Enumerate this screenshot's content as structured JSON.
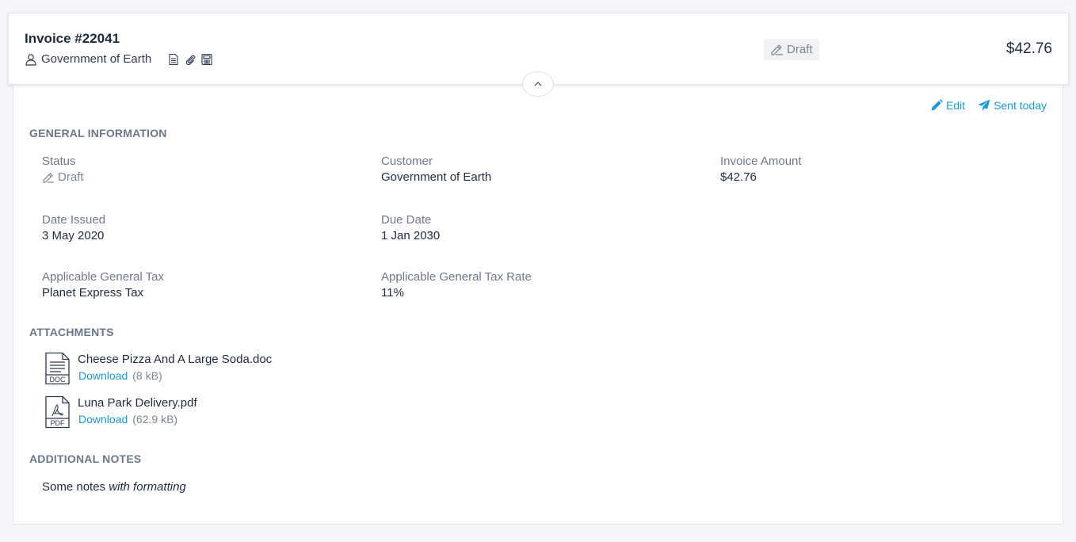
{
  "header": {
    "invoice_title": "Invoice #22041",
    "customer": "Government of Earth",
    "status": "Draft",
    "amount": "$42.76",
    "icons": [
      "document-icon",
      "paperclip-icon",
      "tax-icon"
    ]
  },
  "actions": {
    "edit_label": "Edit",
    "sent_label": "Sent today"
  },
  "general": {
    "section_title": "GENERAL INFORMATION",
    "status_label": "Status",
    "status_value": "Draft",
    "customer_label": "Customer",
    "customer_value": "Government of Earth",
    "amount_label": "Invoice Amount",
    "amount_value": "$42.76",
    "issued_label": "Date Issued",
    "issued_value": "3 May 2020",
    "due_label": "Due Date",
    "due_value": "1 Jan 2030",
    "tax_label": "Applicable General Tax",
    "tax_value": "Planet Express Tax",
    "rate_label": "Applicable General Tax Rate",
    "rate_value": "11%"
  },
  "attachments": {
    "section_title": "ATTACHMENTS",
    "items": [
      {
        "name": "Cheese Pizza And A Large Soda.doc",
        "type": "DOC",
        "download_label": "Download",
        "size": "(8 kB)"
      },
      {
        "name": "Luna Park Delivery.pdf",
        "type": "PDF",
        "download_label": "Download",
        "size": "(62.9 kB)"
      }
    ]
  },
  "notes": {
    "section_title": "ADDITIONAL NOTES",
    "text_plain": "Some notes ",
    "text_italic": "with formatting"
  },
  "colors": {
    "accent": "#1a9ad6",
    "heading": "#1e2b3e",
    "muted": "#6e7a8a",
    "background": "#f4f6f9"
  }
}
